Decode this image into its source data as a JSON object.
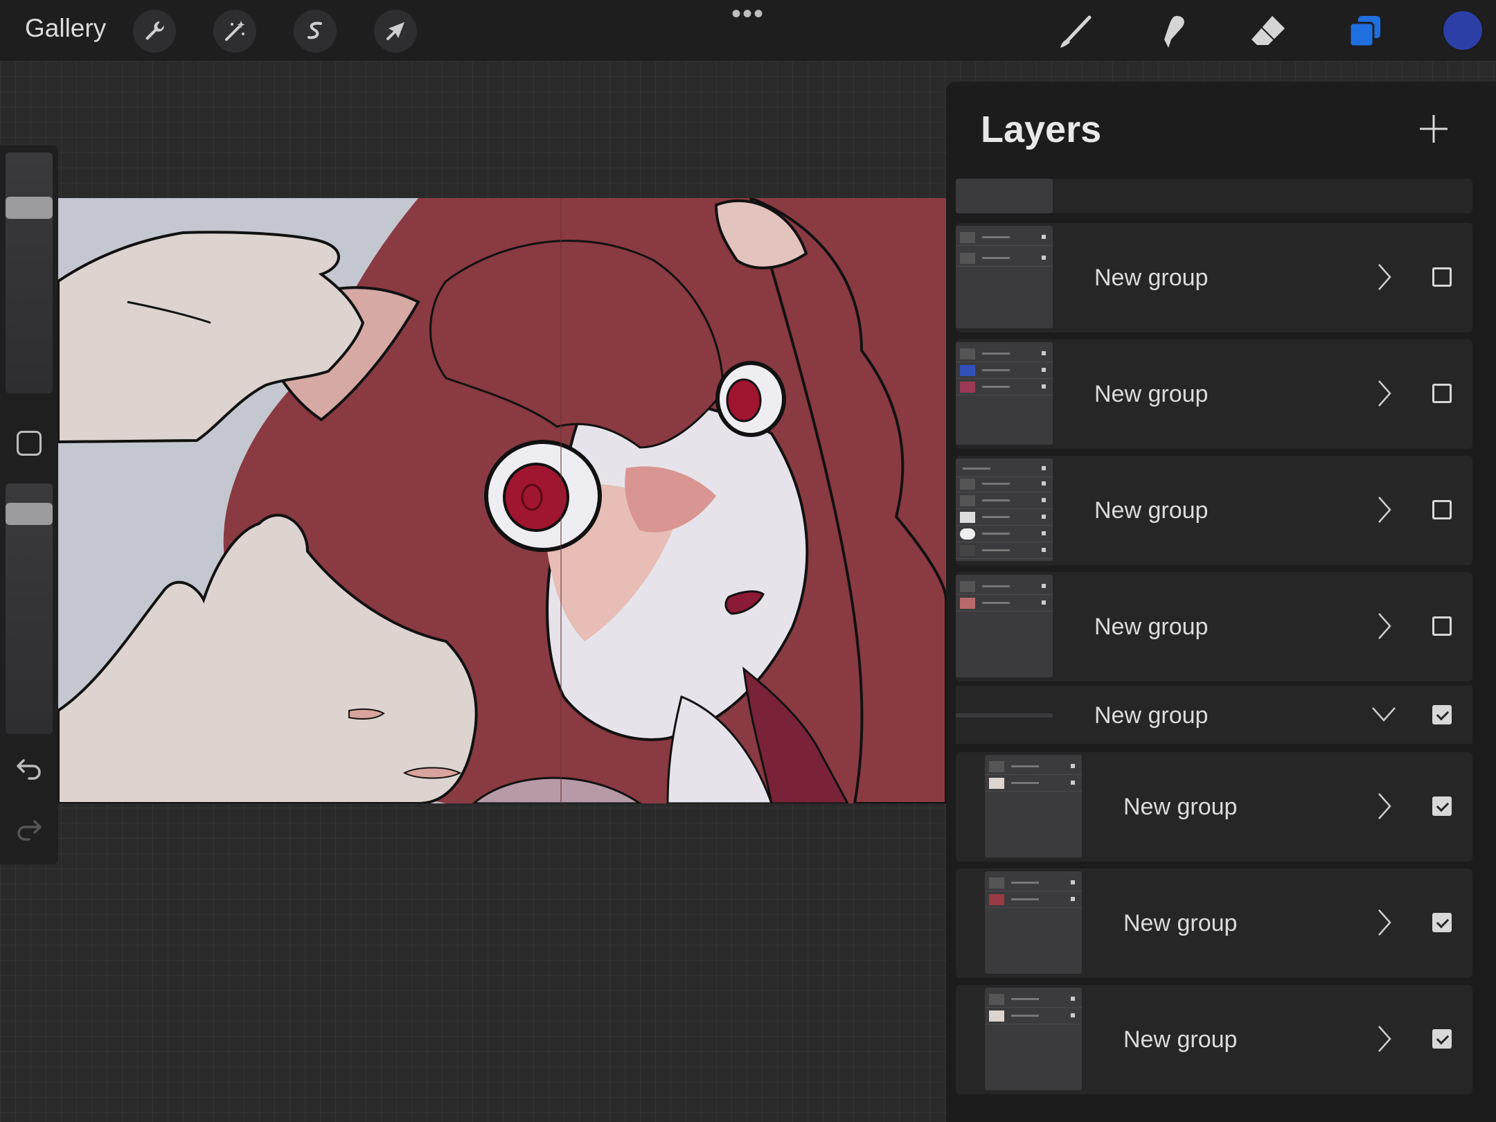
{
  "topbar": {
    "gallery_label": "Gallery",
    "more_label": "•••",
    "tools_left": [
      "wrench-icon",
      "magic-wand-icon",
      "selection-s-icon",
      "transform-arrow-icon"
    ],
    "tools_right": [
      "brush-icon",
      "smudge-icon",
      "eraser-icon",
      "layers-icon"
    ],
    "active_tool": "layers-icon",
    "accent_color": "#1f6fde",
    "current_color": "#2c3fa6"
  },
  "sidebar": {
    "controls": [
      "brush-size-slider",
      "modify-button",
      "opacity-slider",
      "undo-icon",
      "redo-icon"
    ]
  },
  "layers_panel": {
    "title": "Layers",
    "add_icon": "plus-icon",
    "rows": [
      {
        "name": "New group",
        "expanded": false,
        "visible": false,
        "indent": 0
      },
      {
        "name": "New group",
        "expanded": false,
        "visible": false,
        "indent": 0
      },
      {
        "name": "New group",
        "expanded": false,
        "visible": false,
        "indent": 0
      },
      {
        "name": "New group",
        "expanded": false,
        "visible": false,
        "indent": 0
      },
      {
        "name": "New group",
        "expanded": true,
        "visible": true,
        "indent": 0
      },
      {
        "name": "New group",
        "expanded": false,
        "visible": true,
        "indent": 1
      },
      {
        "name": "New group",
        "expanded": false,
        "visible": true,
        "indent": 1
      },
      {
        "name": "New group",
        "expanded": false,
        "visible": true,
        "indent": 1
      }
    ]
  }
}
